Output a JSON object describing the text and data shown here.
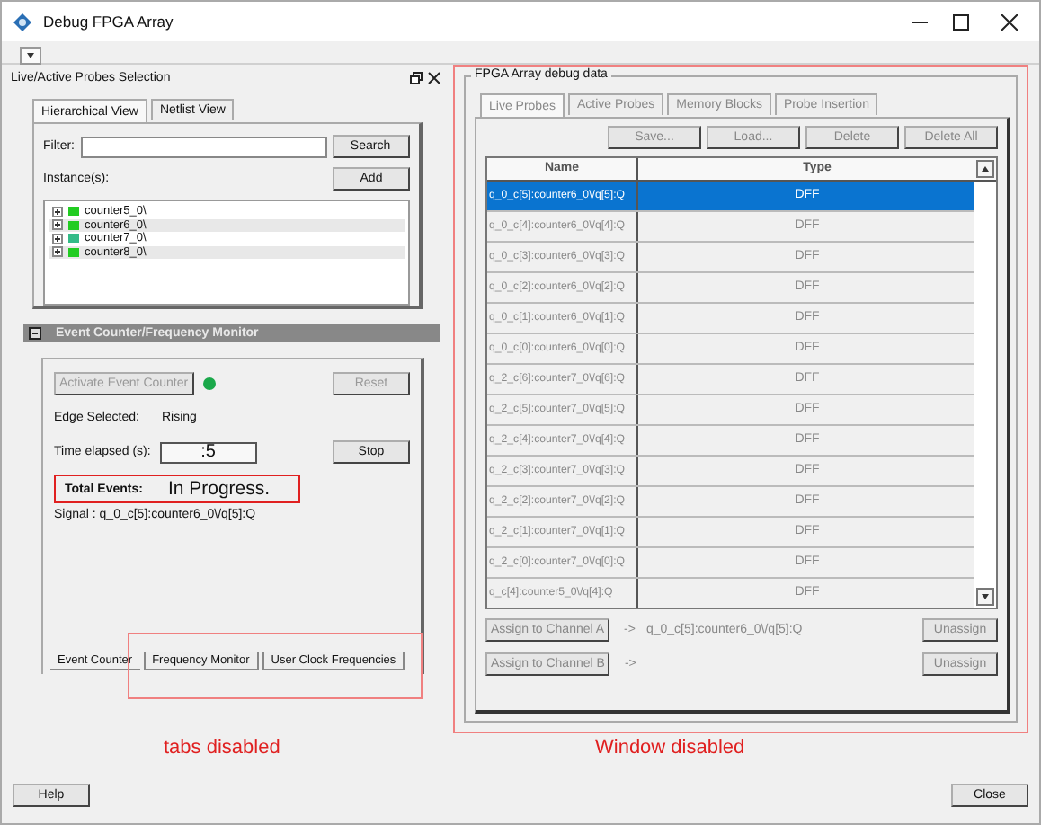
{
  "window": {
    "title": "Debug FPGA Array"
  },
  "probes_selection": {
    "title": "Live/Active Probes Selection",
    "tabs": [
      {
        "label": "Hierarchical View",
        "selected": true
      },
      {
        "label": "Netlist View",
        "selected": false
      }
    ],
    "filter_label": "Filter:",
    "search_button": "Search",
    "instances_label": "Instance(s):",
    "add_button": "Add",
    "instances": [
      {
        "name": "counter5_0\\",
        "color": "#22cc22"
      },
      {
        "name": "counter6_0\\",
        "color": "#22cc22"
      },
      {
        "name": "counter7_0\\",
        "color": "#33bb88"
      },
      {
        "name": "counter8_0\\",
        "color": "#22cc22"
      }
    ]
  },
  "event_monitor": {
    "title": "Event Counter/Frequency Monitor",
    "activate_button": {
      "label": "Activate Event Counter",
      "disabled": true
    },
    "reset_button": {
      "label": "Reset",
      "disabled": true
    },
    "edge_label": "Edge Selected:",
    "edge_value": "Rising",
    "time_label": "Time elapsed (s):",
    "time_value": ":5",
    "stop_button": {
      "label": "Stop",
      "disabled": false
    },
    "total_label": "Total Events:",
    "total_value": "In Progress.",
    "signal": "Signal : q_0_c[5]:counter6_0\\/q[5]:Q",
    "tabs": [
      {
        "label": "Event Counter",
        "selected": true
      },
      {
        "label": "Frequency Monitor",
        "selected": false
      },
      {
        "label": "User Clock Frequencies",
        "selected": false
      }
    ],
    "tabs_note": "tabs disabled"
  },
  "debug_data": {
    "title": "FPGA Array debug data",
    "disabled": true,
    "note": "Window disabled",
    "tabs": [
      {
        "label": "Live Probes",
        "selected": true
      },
      {
        "label": "Active Probes",
        "selected": false
      },
      {
        "label": "Memory Blocks",
        "selected": false
      },
      {
        "label": "Probe Insertion",
        "selected": false
      }
    ],
    "buttons": [
      "Save...",
      "Load...",
      "Delete",
      "Delete All"
    ],
    "table": {
      "columns": [
        "Name",
        "Type"
      ],
      "rows": [
        {
          "cells": [
            "q_0_c[5]:counter6_0\\/q[5]:Q",
            "DFF"
          ],
          "selected": true
        },
        {
          "cells": [
            "q_0_c[4]:counter6_0\\/q[4]:Q",
            "DFF"
          ],
          "selected": false
        },
        {
          "cells": [
            "q_0_c[3]:counter6_0\\/q[3]:Q",
            "DFF"
          ],
          "selected": false
        },
        {
          "cells": [
            "q_0_c[2]:counter6_0\\/q[2]:Q",
            "DFF"
          ],
          "selected": false
        },
        {
          "cells": [
            "q_0_c[1]:counter6_0\\/q[1]:Q",
            "DFF"
          ],
          "selected": false
        },
        {
          "cells": [
            "q_0_c[0]:counter6_0\\/q[0]:Q",
            "DFF"
          ],
          "selected": false
        },
        {
          "cells": [
            "q_2_c[6]:counter7_0\\/q[6]:Q",
            "DFF"
          ],
          "selected": false
        },
        {
          "cells": [
            "q_2_c[5]:counter7_0\\/q[5]:Q",
            "DFF"
          ],
          "selected": false
        },
        {
          "cells": [
            "q_2_c[4]:counter7_0\\/q[4]:Q",
            "DFF"
          ],
          "selected": false
        },
        {
          "cells": [
            "q_2_c[3]:counter7_0\\/q[3]:Q",
            "DFF"
          ],
          "selected": false
        },
        {
          "cells": [
            "q_2_c[2]:counter7_0\\/q[2]:Q",
            "DFF"
          ],
          "selected": false
        },
        {
          "cells": [
            "q_2_c[1]:counter7_0\\/q[1]:Q",
            "DFF"
          ],
          "selected": false
        },
        {
          "cells": [
            "q_2_c[0]:counter7_0\\/q[0]:Q",
            "DFF"
          ],
          "selected": false
        },
        {
          "cells": [
            "q_c[4]:counter5_0\\/q[4]:Q",
            "DFF"
          ],
          "selected": false
        }
      ]
    },
    "channels": [
      {
        "button": "Assign to Channel A",
        "arrow": "->",
        "signal": "q_0_c[5]:counter6_0\\/q[5]:Q",
        "unassign": "Unassign"
      },
      {
        "button": "Assign to Channel B",
        "arrow": "->",
        "unassign": "Unassign"
      }
    ]
  },
  "footer": {
    "help_button": "Help",
    "close_button": "Close"
  }
}
